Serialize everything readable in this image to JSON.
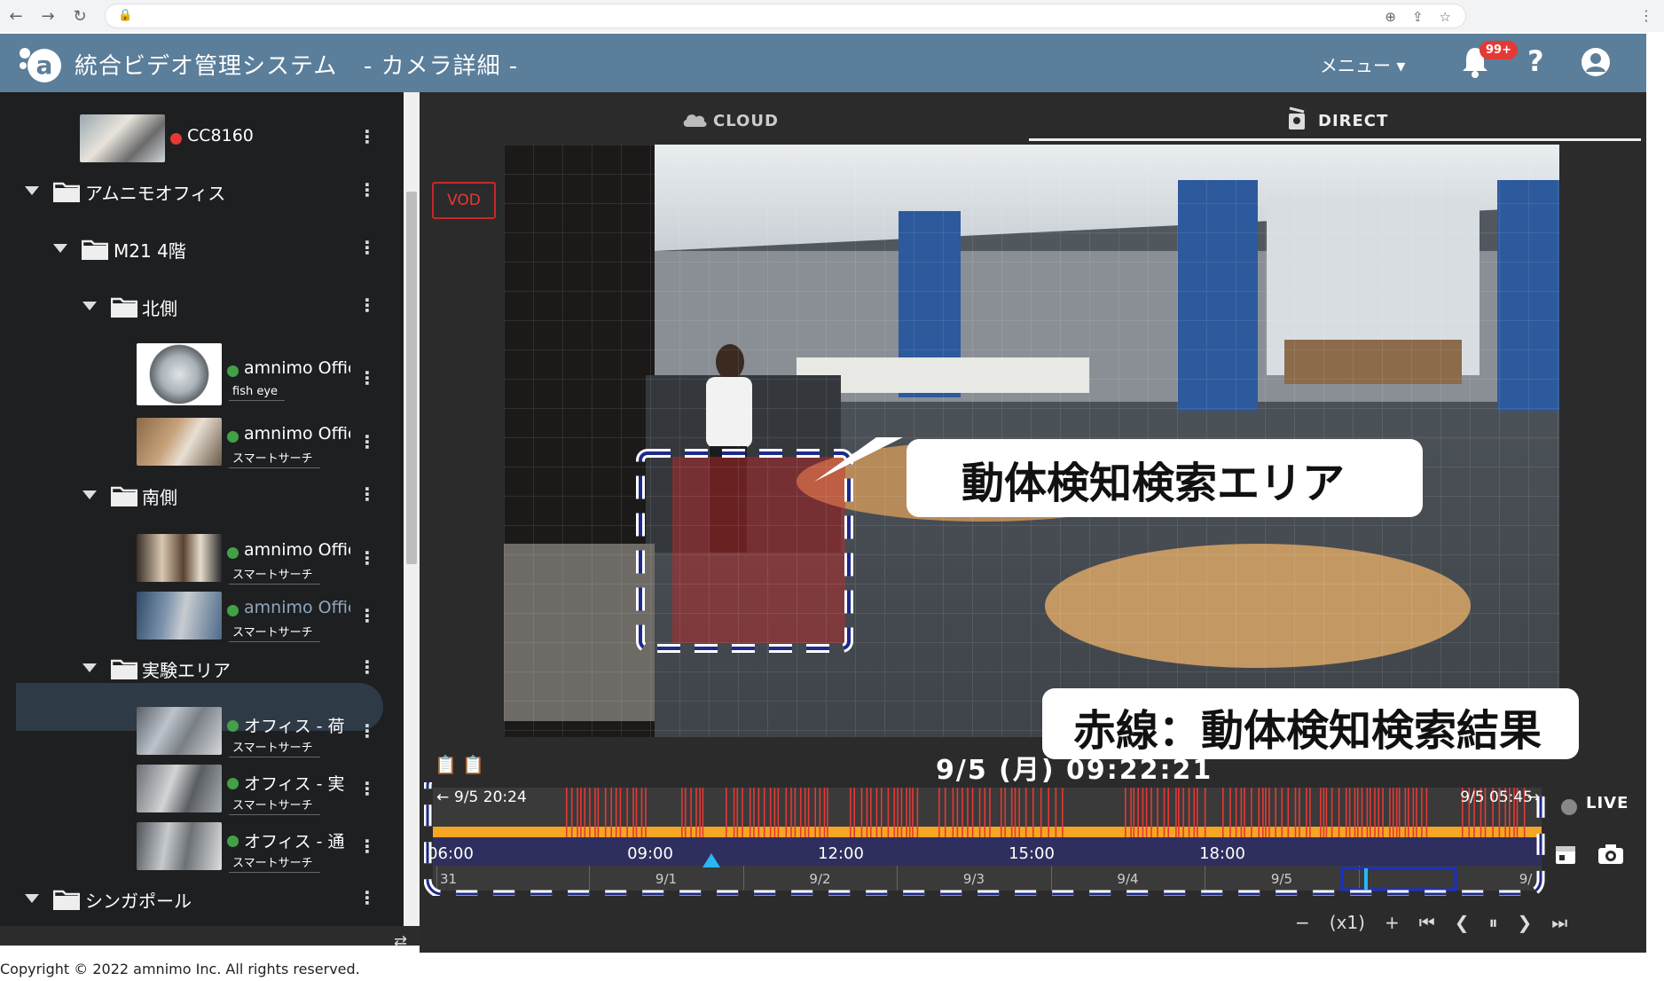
{
  "browser": {
    "nav": [
      "←",
      "→",
      "↻"
    ],
    "lock": "🔒",
    "tools": [
      "⊕",
      "⇪",
      "☆"
    ],
    "menu": "⋮"
  },
  "header": {
    "app_title": "統合ビデオ管理システム",
    "page_subtitle": "- カメラ詳細 -",
    "menu_label": "メニュー ▾",
    "notification_count": "99+",
    "help": "?",
    "brand_color": "#5b7e9a"
  },
  "sidebar": {
    "items": [
      {
        "type": "camera",
        "name": "CC8160",
        "status": "offline",
        "tag": ""
      },
      {
        "type": "folder",
        "name": "アムニモオフィス",
        "level": 0
      },
      {
        "type": "folder",
        "name": "M21 4階",
        "level": 1
      },
      {
        "type": "folder",
        "name": "北側",
        "level": 2
      },
      {
        "type": "camera",
        "name": "amnimo Offic",
        "status": "online",
        "tag": "fish eye"
      },
      {
        "type": "camera",
        "name": "amnimo Offic",
        "status": "online",
        "tag": "スマートサーチ"
      },
      {
        "type": "folder",
        "name": "南側",
        "level": 2
      },
      {
        "type": "camera",
        "name": "amnimo Offic",
        "status": "online",
        "tag": "スマートサーチ"
      },
      {
        "type": "camera",
        "name": "amnimo Offic",
        "status": "online",
        "tag": "スマートサーチ",
        "selected": true
      },
      {
        "type": "folder",
        "name": "実験エリア",
        "level": 2
      },
      {
        "type": "camera",
        "name": "オフィス - 荷",
        "status": "online",
        "tag": "スマートサーチ"
      },
      {
        "type": "camera",
        "name": "オフィス - 実",
        "status": "online",
        "tag": "スマートサーチ"
      },
      {
        "type": "camera",
        "name": "オフィス - 通",
        "status": "online",
        "tag": "スマートサーチ"
      },
      {
        "type": "folder",
        "name": "シンガポール",
        "level": 0
      }
    ],
    "kebab": "⋮",
    "swap": "⇄"
  },
  "footer": {
    "copyright": "Copyright © 2022 amnimo Inc. All rights reserved."
  },
  "main": {
    "tabs": [
      {
        "label": "CLOUD",
        "active": false
      },
      {
        "label": "DIRECT",
        "active": true
      }
    ],
    "vod_label": "VOD",
    "callout_area": "動体検知検索エリア",
    "callout_result": "赤線：動体検知検索結果",
    "timestamp": "9/5 (月) 09:22:21"
  },
  "timeline": {
    "range_start": "9/5 20:24",
    "range_end": "9/5 05:45",
    "hours": [
      "06:00",
      "09:00",
      "12:00",
      "15:00",
      "18:00"
    ],
    "days": [
      "31",
      "9/1",
      "9/2",
      "9/3",
      "9/4",
      "9/5",
      "9/"
    ],
    "selected_day": "9/5",
    "live_label": "LIVE",
    "controls": [
      "−",
      "(x1)",
      "+",
      "⏮",
      "❮",
      "⏸",
      "❯",
      "⏭"
    ],
    "accent_color": "#e53935",
    "bar_color": "#f5a623"
  }
}
